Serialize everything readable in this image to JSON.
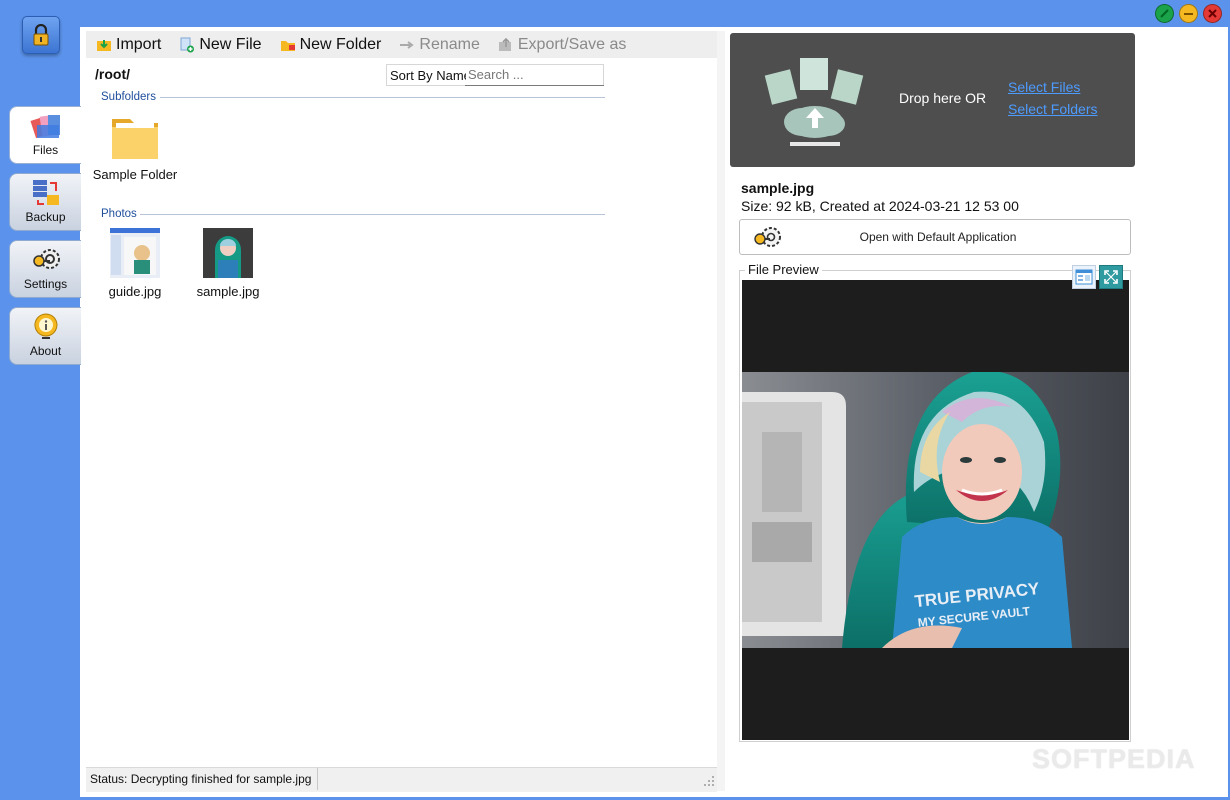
{
  "sidebar": {
    "items": [
      {
        "label": "Files",
        "icon": "files-icon"
      },
      {
        "label": "Backup",
        "icon": "backup-icon"
      },
      {
        "label": "Settings",
        "icon": "settings-icon"
      },
      {
        "label": "About",
        "icon": "about-icon"
      }
    ],
    "active": "Files"
  },
  "toolbar": {
    "import_label": "Import",
    "new_file_label": "New File",
    "new_folder_label": "New Folder",
    "rename_label": "Rename",
    "export_label": "Export/Save as"
  },
  "browser": {
    "path": "/root/",
    "sort_label": "Sort By Name",
    "search_placeholder": "Search ...",
    "subfolders_header": "Subfolders",
    "folders": [
      {
        "name": "Sample Folder"
      }
    ],
    "photos_header": "Photos",
    "photos": [
      {
        "name": "guide.jpg"
      },
      {
        "name": "sample.jpg"
      }
    ]
  },
  "status": {
    "text": "Status: Decrypting finished for sample.jpg"
  },
  "dropzone": {
    "text": "Drop here OR",
    "select_files": "Select Files",
    "select_folders": "Select Folders"
  },
  "details": {
    "file_name": "sample.jpg",
    "file_info": "Size: 92 kB, Created at 2024-03-21 12 53 00",
    "open_button": "Open with Default Application"
  },
  "preview": {
    "title": "File Preview",
    "image_text_line1": "TRUE PRIVACY",
    "image_text_line2": "MY SECURE VAULT"
  },
  "watermark": "SOFTPEDIA",
  "colors": {
    "frame": "#5b93ec",
    "dropzone": "#4e4e4e",
    "link": "#4d9bff",
    "close": "#e53935",
    "minimize": "#f5b820",
    "maximize": "#1aa34a"
  }
}
